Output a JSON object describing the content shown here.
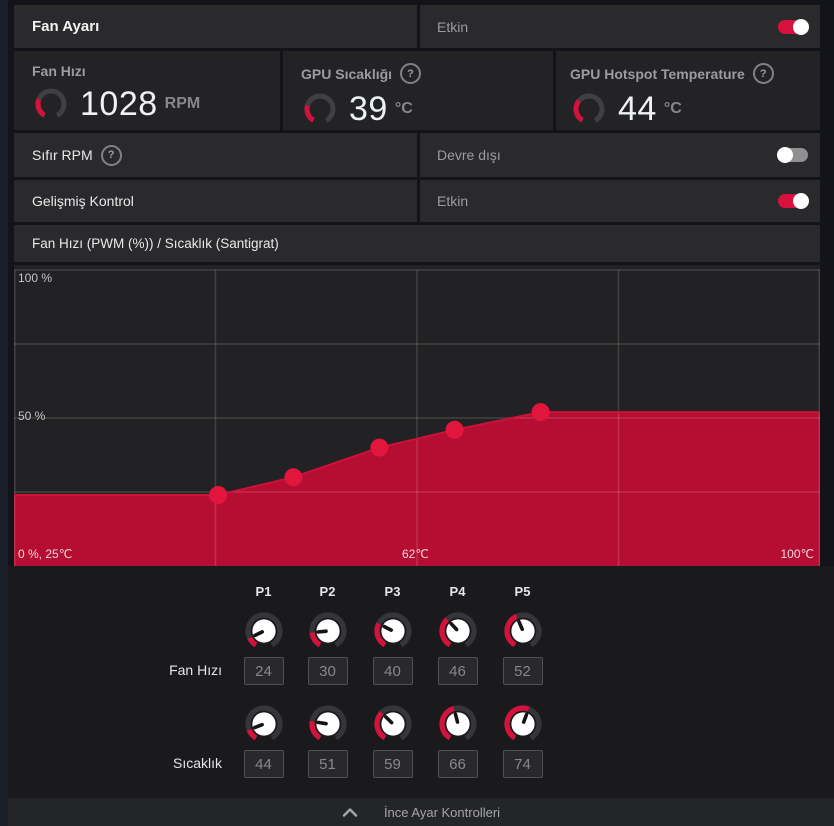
{
  "header": {
    "title": "Fan Ayarı",
    "status_label": "Etkin",
    "enabled": true
  },
  "metrics": [
    {
      "label": "Fan Hızı",
      "value": "1028",
      "unit": "RPM",
      "help": false,
      "gauge_fraction": 0.27
    },
    {
      "label": "GPU Sıcaklığı",
      "value": "39",
      "unit": "°C",
      "help": true,
      "gauge_fraction": 0.25
    },
    {
      "label": "GPU Hotspot Temperature",
      "value": "44",
      "unit": "°C",
      "help": true,
      "gauge_fraction": 0.33
    }
  ],
  "rows": [
    {
      "label": "Sıfır RPM",
      "help": true,
      "status_label": "Devre dışı",
      "enabled": false
    },
    {
      "label": "Gelişmiş Kontrol",
      "help": false,
      "status_label": "Etkin",
      "enabled": true
    }
  ],
  "chart": {
    "y_top_label": "100 %",
    "y_mid_label": "50 %",
    "x_left_label": "0 %, 25℃",
    "x_mid_label": "62℃",
    "x_right_label": "100℃"
  },
  "chart_data": {
    "type": "area",
    "title": "Fan Hızı (PWM (%)) / Sıcaklık (Santigrat)",
    "x": [
      44,
      51,
      59,
      66,
      74
    ],
    "series": [
      {
        "name": "Fan Hızı (PWM %)",
        "values": [
          24,
          30,
          40,
          46,
          52
        ]
      }
    ],
    "xlabel": "Sıcaklık (Santigrat)",
    "ylabel": "Fan Hızı (PWM %)",
    "xlim": [
      25,
      100
    ],
    "ylim": [
      0,
      100
    ],
    "grid": true,
    "flat_before_first_point": true,
    "flat_after_last_point": true,
    "fill_color": "#b60d33",
    "line_color": "#cf1038",
    "dot_color": "#e2163c",
    "grid_color": "rgba(255,255,255,0.14)"
  },
  "tuning": {
    "point_labels": [
      "P1",
      "P2",
      "P3",
      "P4",
      "P5"
    ],
    "fan_label": "Fan Hızı",
    "temp_label": "Sıcaklık",
    "fan_values": [
      24,
      30,
      40,
      46,
      52
    ],
    "temp_values": [
      44,
      51,
      59,
      66,
      74
    ],
    "temp_min": 25,
    "temp_max": 100
  },
  "footer": {
    "label": "İnce Ayar Kontrolleri",
    "icon": "chevron-up"
  },
  "colors": {
    "accent_red": "#d5123d",
    "toggle_off": "#8f9092",
    "gauge_track": "#3f4042",
    "knob_face": "#ffffff",
    "knob_needle": "#141414"
  }
}
